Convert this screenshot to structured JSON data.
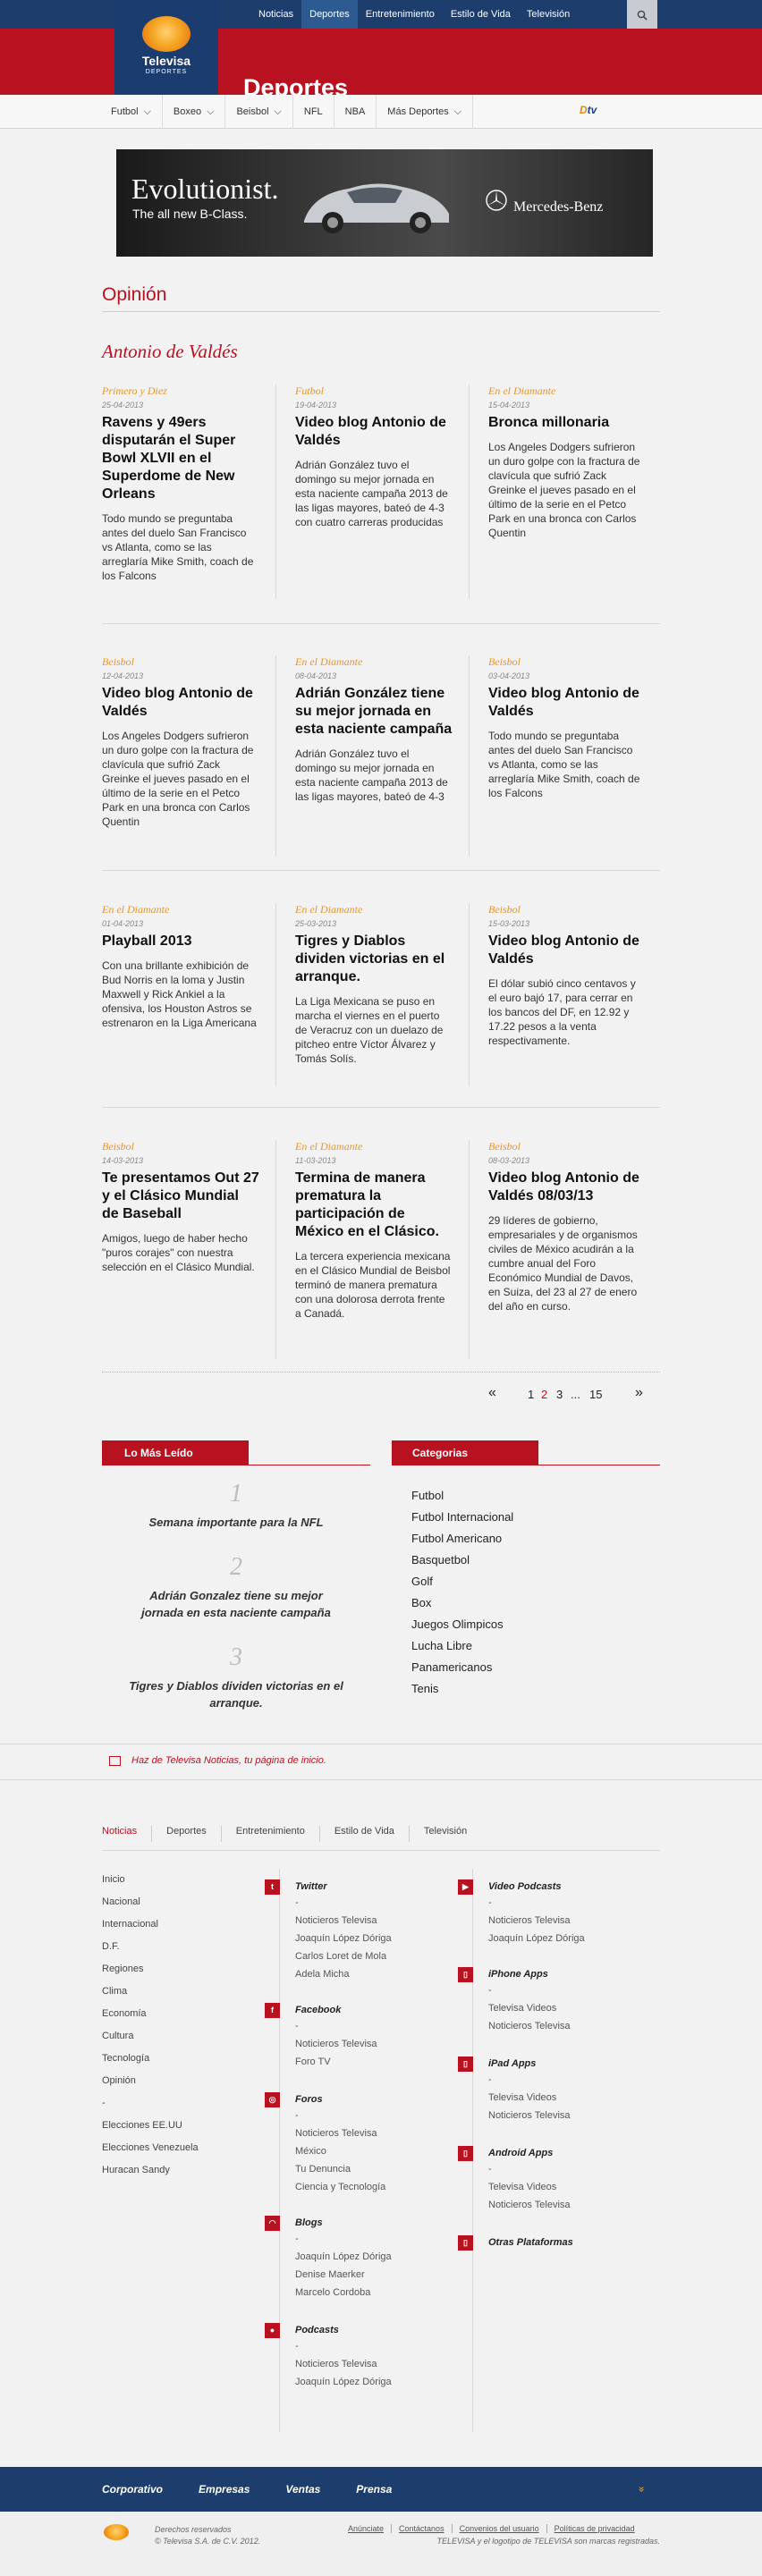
{
  "top_nav": {
    "items": [
      "Noticias",
      "Deportes",
      "Entretenimiento",
      "Estilo de Vida",
      "Televisión"
    ],
    "active": 1
  },
  "logo": {
    "name": "Televisa",
    "sub": "DEPORTES"
  },
  "section_title": "Deportes",
  "sub_nav": {
    "items": [
      "Futbol",
      "Boxeo",
      "Beisbol",
      "NFL",
      "NBA",
      "Más Deportes"
    ],
    "has_dropdown": [
      true,
      true,
      true,
      false,
      false,
      true
    ],
    "partner_logo": {
      "left": "D",
      "right": "tv"
    }
  },
  "banner": {
    "headline": "Evolutionist.",
    "subline": "The all new B-Class.",
    "brand": "Mercedes-Benz"
  },
  "opinion_title": "Opinión",
  "author": "Antonio de Valdés",
  "articles": [
    {
      "category": "Primero y Diez",
      "date": "25-04-2013",
      "title": "Ravens y 49ers disputarán el Super Bowl XLVII en el Superdome de New Orleans",
      "summary": "Todo mundo se preguntaba antes del duelo San Francisco vs Atlanta, como se las arreglaría Mike Smith, coach de los Falcons"
    },
    {
      "category": "Futbol",
      "date": "19-04-2013",
      "title": "Video blog Antonio de Valdés",
      "summary": "Adrián González tuvo el domingo su mejor jornada en esta naciente campaña 2013 de las ligas mayores, bateó de 4-3 con cuatro carreras producidas"
    },
    {
      "category": "En el Diamante",
      "date": "15-04-2013",
      "title": "Bronca millonaria",
      "summary": "Los Angeles Dodgers sufrieron un duro golpe con la fractura de clavícula que sufrió Zack Greinke el jueves pasado en el último de la serie en el Petco Park en una bronca con Carlos Quentin"
    },
    {
      "category": "Beisbol",
      "date": "12-04-2013",
      "title": "Video blog Antonio de Valdés",
      "summary": "Los Angeles Dodgers sufrieron un duro golpe con la fractura de clavícula que sufrió Zack Greinke el jueves pasado en el último de la serie en el Petco Park en una bronca con Carlos Quentin"
    },
    {
      "category": "En el Diamante",
      "date": "08-04-2013",
      "title": "Adrián González tiene su mejor jornada en esta naciente campaña",
      "summary": "Adrián González tuvo el domingo su mejor jornada en esta naciente campaña 2013 de las ligas mayores, bateó de 4-3"
    },
    {
      "category": "Beisbol",
      "date": "03-04-2013",
      "title": "Video blog Antonio de Valdés",
      "summary": "Todo mundo se preguntaba antes del duelo San Francisco vs Atlanta, como se las arreglaría Mike Smith, coach de los Falcons"
    },
    {
      "category": "En el Diamante",
      "date": "01-04-2013",
      "title": "Playball 2013",
      "summary": "Con una brillante exhibición de Bud Norris en la loma y Justin Maxwell y Rick Ankiel a la ofensiva, los Houston Astros se estrenaron en la Liga Americana"
    },
    {
      "category": "En el Diamante",
      "date": "25-03-2013",
      "title": "Tigres y Diablos dividen victorias en el arranque.",
      "summary": "La Liga Mexicana se puso en marcha el viernes en el puerto de Veracruz con un duelazo de pitcheo entre Víctor Álvarez y Tomás Solís."
    },
    {
      "category": "Beisbol",
      "date": "15-03-2013",
      "title": "Video blog Antonio de Valdés",
      "summary": "El dólar subió cinco centavos y el euro bajó 17, para cerrar en los bancos del DF, en 12.92 y 17.22 pesos a la venta respectivamente."
    },
    {
      "category": "Beisbol",
      "date": "14-03-2013",
      "title": "Te presentamos Out 27 y el Clásico Mundial de Baseball",
      "summary": "Amigos, luego de haber hecho \"puros corajes\" con nuestra selección en el Clásico Mundial."
    },
    {
      "category": "En el Diamante",
      "date": "11-03-2013",
      "title": "Termina de manera prematura la participación de México en el Clásico.",
      "summary": "La tercera experiencia mexicana en el Clásico Mundial de Beisbol terminó de manera prematura con una dolorosa derrota frente a Canadá."
    },
    {
      "category": "Beisbol",
      "date": "08-03-2013",
      "title": "Video blog Antonio de Valdés 08/03/13",
      "summary": "29 líderes de gobierno, empresariales y de organismos civiles de México acudirán a la cumbre anual del Foro Económico Mundial de Davos, en Suiza, del 23 al 27 de enero del año en curso."
    }
  ],
  "pagination": {
    "prev": "«",
    "pages": [
      "1",
      "2",
      "3",
      "...",
      "15"
    ],
    "current": "2",
    "next": "»"
  },
  "mas_leido": {
    "label": "Lo Más Leído",
    "items": [
      {
        "rank": "1",
        "title": "Semana importante para la NFL"
      },
      {
        "rank": "2",
        "title": "Adrián Gonzalez tiene su mejor jornada en esta naciente campaña"
      },
      {
        "rank": "3",
        "title": "Tigres y Diablos dividen victorias en el arranque."
      }
    ]
  },
  "categorias": {
    "label": "Categorias",
    "items": [
      "Futbol",
      "Futbol Internacional",
      "Futbol Americano",
      "Basquetbol",
      "Golf",
      "Box",
      "Juegos Olimpicos",
      "Lucha Libre",
      "Panamericanos",
      "Tenis"
    ]
  },
  "homepage_prompt": "Haz de Televisa Noticias, tu página de inicio.",
  "footer_tabs": [
    "Noticias",
    "Deportes",
    "Entretenimiento",
    "Estilo de Vida",
    "Televisión"
  ],
  "footer_col1": [
    "Inicio",
    "Nacional",
    "Internacional",
    "D.F.",
    "Regiones",
    "Clima",
    "Economía",
    "Cultura",
    "Tecnología",
    "Opinión",
    "-",
    "Elecciones EE.UU",
    "Elecciones Venezuela",
    "Huracan Sandy"
  ],
  "footer_social_col2": [
    {
      "icon": "twitter-icon",
      "glyph": "t",
      "heading": "Twitter",
      "links": [
        "-",
        "Noticieros Televisa",
        "Joaquín López Dóriga",
        "Carlos Loret de Mola",
        "Adela Micha"
      ]
    },
    {
      "icon": "facebook-icon",
      "glyph": "f",
      "heading": "Facebook",
      "links": [
        "-",
        "Noticieros Televisa",
        "Foro TV"
      ]
    },
    {
      "icon": "foros-icon",
      "glyph": "◎",
      "heading": "Foros",
      "links": [
        "-",
        "Noticieros Televisa",
        "México",
        "Tu Denuncia",
        "Ciencia y Tecnología"
      ]
    },
    {
      "icon": "rss-icon",
      "glyph": "◠",
      "heading": "Blogs",
      "links": [
        "-",
        "Joaquín López Dóriga",
        "Denise Maerker",
        "Marcelo Cordoba"
      ]
    },
    {
      "icon": "microphone-icon",
      "glyph": "●",
      "heading": "Podcasts",
      "links": [
        "-",
        "Noticieros Televisa",
        "Joaquín López Dóriga"
      ]
    }
  ],
  "footer_social_col3": [
    {
      "icon": "video-podcast-icon",
      "glyph": "▶",
      "heading": "Video Podcasts",
      "links": [
        "-",
        "Noticieros Televisa",
        "Joaquín López Dóriga"
      ]
    },
    {
      "icon": "iphone-icon",
      "glyph": "▯",
      "heading": "iPhone Apps",
      "links": [
        "-",
        "Televisa Videos",
        "Noticieros Televisa"
      ]
    },
    {
      "icon": "ipad-icon",
      "glyph": "▯",
      "heading": "iPad Apps",
      "links": [
        "-",
        "Televisa Videos",
        "Noticieros Televisa"
      ]
    },
    {
      "icon": "android-icon",
      "glyph": "▯",
      "heading": "Android Apps",
      "links": [
        "-",
        "Televisa Videos",
        "Noticieros Televisa"
      ]
    },
    {
      "icon": "otras-plataformas-icon",
      "glyph": "▯",
      "heading": "Otras Plataformas",
      "links": []
    }
  ],
  "footer_bar": {
    "links": [
      "Corporativo",
      "Empresas",
      "Ventas",
      "Prensa"
    ],
    "chevron": "»"
  },
  "bottom": {
    "copyright": [
      "Derechos reservados",
      "© Televisa S.A. de C.V. 2012."
    ],
    "links": [
      "Anúnciate",
      "Contáctanos",
      "Convenios del usuario",
      "Políticas de privacidad"
    ],
    "legal": "TELEVISA y el logotipo de TELEVISA son marcas registradas."
  },
  "colors": {
    "brand_red": "#b81221",
    "nav_blue": "#1d3e6d",
    "category_orange": "#e6962e",
    "accent_orange": "#f5a623"
  }
}
